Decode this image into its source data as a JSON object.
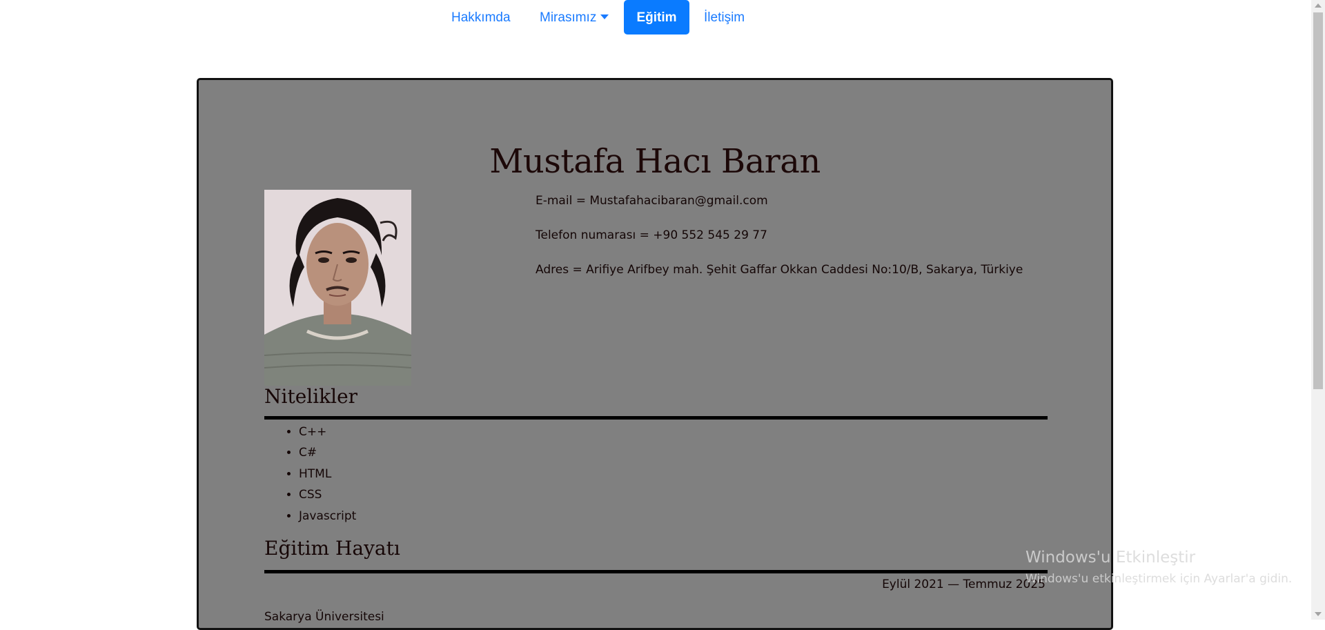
{
  "nav": {
    "items": [
      {
        "label": "Hakkımda"
      },
      {
        "label": "Mirasımız"
      },
      {
        "label": "Eğitim"
      },
      {
        "label": "İletişim"
      }
    ],
    "active_color": "#0a7bff",
    "link_color": "#1a7bff"
  },
  "profile": {
    "name": "Mustafa Hacı Baran",
    "email": "E-mail = Mustafahacibaran@gmail.com",
    "phone": "Telefon numarası = +90 552 545 29 77",
    "address": "Adres = Arifiye Arifbey mah. Şehit Gaffar Okkan Caddesi No:10/B, Sakarya, Türkiye"
  },
  "skills": {
    "title": "Nitelikler",
    "items": [
      "C++",
      "C#",
      "HTML",
      "CSS",
      "Javascript"
    ]
  },
  "education": {
    "title": "Eğitim Hayatı",
    "date_range": "Eylül 2021 — Temmuz 2025",
    "school": "Sakarya Üniversitesi"
  },
  "watermark": {
    "title": "Windows'u Etkinleştir",
    "subtitle": "Windows'u etkinleştirmek için Ayarlar'a gidin."
  },
  "colors": {
    "card_background": "#808080",
    "text": "#140606"
  }
}
